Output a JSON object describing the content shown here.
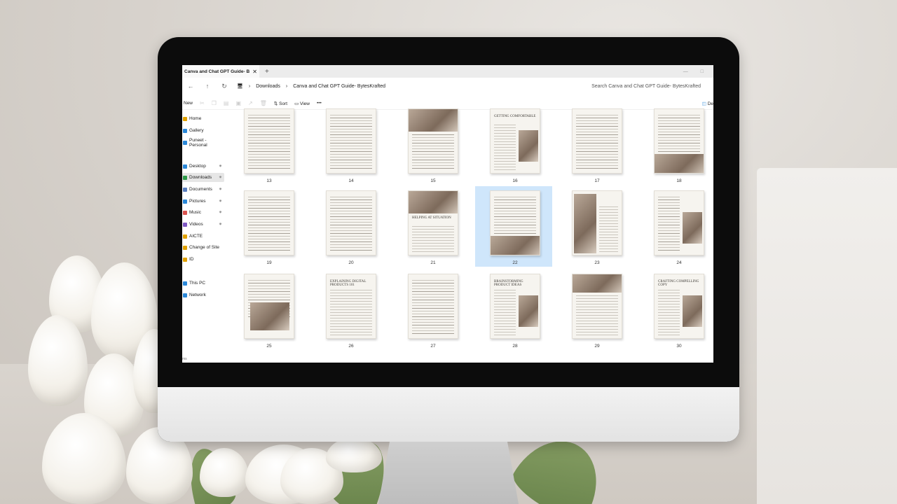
{
  "window": {
    "tab_title": "Canva and Chat GPT Guide- B",
    "tab_close": "✕",
    "new_tab": "+"
  },
  "address": {
    "breadcrumb": [
      "Downloads",
      "Canva and Chat GPT Guide- BytesKrafted"
    ],
    "search_placeholder": "Search Canva and Chat GPT Guide- BytesKrafted"
  },
  "toolbar": {
    "new_label": "New",
    "sort_label": "Sort",
    "view_label": "View",
    "more_label": "•••",
    "details_label": "De"
  },
  "sidebar": {
    "items": [
      {
        "label": "Home",
        "color": "#e0a100"
      },
      {
        "label": "Gallery",
        "color": "#2b88d8"
      },
      {
        "label": "Puneet - Personal",
        "color": "#2b88d8"
      },
      {
        "label": "Desktop",
        "color": "#2b88d8",
        "pinned": true
      },
      {
        "label": "Downloads",
        "color": "#2e9b4a",
        "pinned": true,
        "active": true
      },
      {
        "label": "Documents",
        "color": "#5b7fbf",
        "pinned": true
      },
      {
        "label": "Pictures",
        "color": "#2b88d8",
        "pinned": true
      },
      {
        "label": "Music",
        "color": "#d9534f",
        "pinned": true
      },
      {
        "label": "Videos",
        "color": "#7e57c2",
        "pinned": true
      },
      {
        "label": "AICTE",
        "color": "#e0a100"
      },
      {
        "label": "Change of Site",
        "color": "#e0a100"
      },
      {
        "label": "ID",
        "color": "#e0a100"
      },
      {
        "label": "This PC",
        "color": "#2b88d8"
      },
      {
        "label": "Network",
        "color": "#2b88d8"
      }
    ],
    "pin_glyph": "✷"
  },
  "files": {
    "pages": [
      "13",
      "14",
      "15",
      "16",
      "17",
      "18",
      "19",
      "20",
      "21",
      "22",
      "23",
      "24",
      "25",
      "26",
      "27",
      "28",
      "29",
      "30"
    ],
    "selected": "22",
    "headings": {
      "16": "GETTING COMFORTABLE",
      "21": "HELPING AT SITUATION",
      "23": "CHAPTER 2",
      "26": "EXPLAINING DIGITAL PRODUCTS 101",
      "28": "BRAINSTORMING PRODUCT IDEAS",
      "30": "CRAFTING COMPELLING COPY"
    }
  },
  "status": {
    "text": "ms"
  }
}
